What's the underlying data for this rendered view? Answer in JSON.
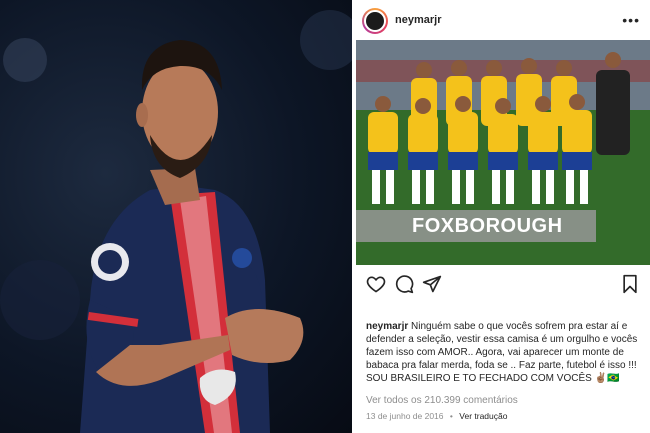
{
  "photo": {
    "jersey_badge_text": "PSG"
  },
  "post": {
    "username": "neymarjr",
    "image_banner": "FOXBOROUGH",
    "caption_username": "neymarjr",
    "caption_text": "Ninguém sabe o que vocês sofrem pra estar aí e defender a seleção, vestir essa camisa é um orgulho e vocês fazem isso com AMOR.. Agora, vai aparecer um monte de babaca pra falar merda, foda se .. Faz parte, futebol é isso !!!",
    "caption_line2": "SOU BRASILEIRO E TO FECHADO COM VOCÊS ✌🏽🇧🇷",
    "comments_link": "Ver todos os 210.399 comentários",
    "date": "13 de junho de 2016",
    "separator": "•",
    "translate_link": "Ver tradução"
  },
  "icons": {
    "like": "heart-icon",
    "comment": "comment-icon",
    "share": "share-icon",
    "save": "bookmark-icon",
    "more": "more-icon"
  },
  "colors": {
    "jersey_navy": "#1b2a55",
    "jersey_red": "#d32f3a",
    "brazil_yellow": "#f4c21b",
    "brazil_blue": "#1c3f95"
  }
}
